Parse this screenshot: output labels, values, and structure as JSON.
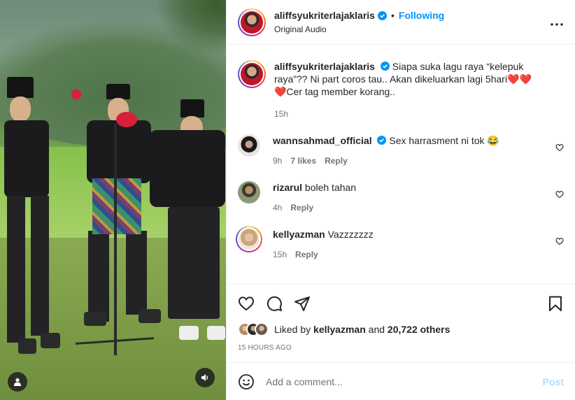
{
  "header": {
    "username": "aliffsyukriterlajaklaris",
    "separator": "•",
    "follow_label": "Following",
    "audio": "Original Audio",
    "more_icon": "more-horizontal-icon"
  },
  "caption": {
    "username": "aliffsyukriterlajaklaris",
    "text": "Siapa suka lagu raya “kelepuk raya”?? Ni part coros tau.. Akan dikeluarkan lagi 5hari❤️❤️❤️Cer tag member korang..",
    "time": "15h"
  },
  "comments": [
    {
      "username": "wannsahmad_official",
      "verified": true,
      "text": "Sex harrasment ni tok 😂",
      "time": "9h",
      "likes": "7 likes",
      "reply": "Reply"
    },
    {
      "username": "rizarul",
      "verified": false,
      "text": "boleh tahan",
      "time": "4h",
      "likes": "",
      "reply": "Reply"
    },
    {
      "username": "kellyazman",
      "verified": false,
      "text": "Vazzzzzzz",
      "time": "15h",
      "likes": "",
      "reply": "Reply"
    }
  ],
  "likes": {
    "prefix": "Liked by",
    "first": "kellyazman",
    "and": "and",
    "others": "20,722 others"
  },
  "time_ago": "15 HOURS AGO",
  "composer": {
    "placeholder": "Add a comment...",
    "post_label": "Post"
  },
  "colors": {
    "accent": "#0095f6",
    "post_disabled": "#b3dbff",
    "heart_emoji": "#e0245e"
  }
}
